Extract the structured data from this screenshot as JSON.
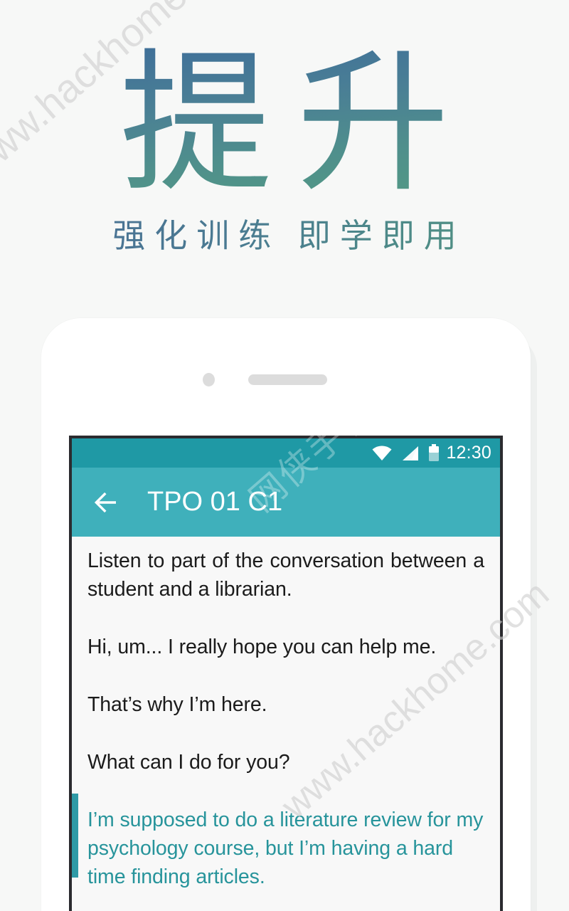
{
  "page": {
    "background_color": "#f7f8f7"
  },
  "hero": {
    "title": "提升",
    "subtitle": "强化训练 即学即用",
    "gradient_start": "#3f6f99",
    "gradient_end": "#539b83"
  },
  "watermarks": {
    "site": "www.hackhome.com",
    "site_2": "www.hackhome.com",
    "overlay_cn": "网侠手机"
  },
  "phone": {
    "body_color": "#ffffff",
    "bezel_color": "#2b2b2f",
    "camera_icon": "camera-dot",
    "speaker_icon": "speaker-grille"
  },
  "status_bar": {
    "background_color": "#1f99a5",
    "clock": "12:30",
    "icons": [
      {
        "name": "wifi-icon",
        "label": "wifi"
      },
      {
        "name": "cellular-signal-icon",
        "label": "signal"
      },
      {
        "name": "battery-icon",
        "label": "battery"
      }
    ]
  },
  "app_bar": {
    "background_color": "#3fb0bb",
    "back_icon": "back-arrow-icon",
    "title": "TPO 01 C1"
  },
  "transcript": {
    "text_color": "#1b1b1b",
    "highlight_color": "#27949b",
    "highlight_bar_color": "#2e9aa6",
    "paragraphs": [
      {
        "text": "Listen to part of the conversation between a student and a librarian.",
        "highlighted": false
      },
      {
        "text": "Hi, um... I really hope you can help me.",
        "highlighted": false
      },
      {
        "text": "That’s why I’m here.",
        "highlighted": false
      },
      {
        "text": "What can I do for you?",
        "highlighted": false
      },
      {
        "text": "I’m supposed to do a literature review for my psychology course, but I’m having a hard time finding articles.",
        "highlighted": true
      }
    ]
  }
}
